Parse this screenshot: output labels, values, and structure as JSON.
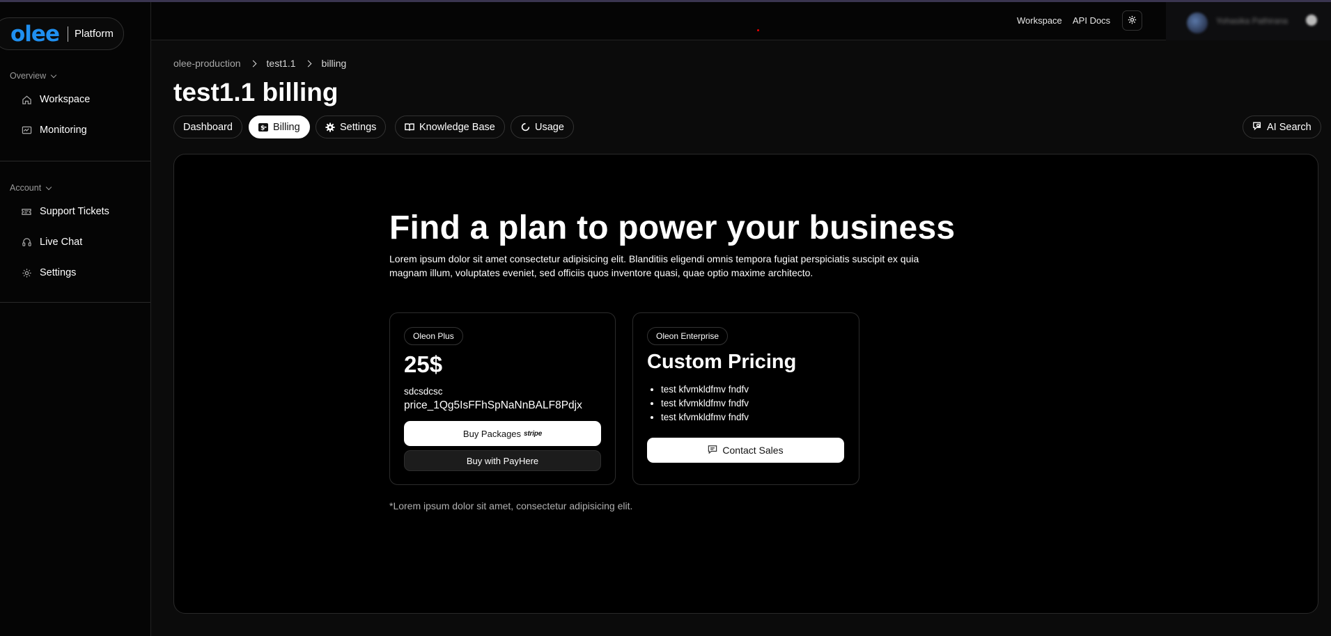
{
  "brand": {
    "logo": "olee",
    "product": "Platform"
  },
  "sidebar": {
    "sections": [
      {
        "label": "Overview",
        "items": [
          {
            "label": "Workspace",
            "icon": "home-icon"
          },
          {
            "label": "Monitoring",
            "icon": "monitor-icon"
          }
        ]
      },
      {
        "label": "Account",
        "items": [
          {
            "label": "Support Tickets",
            "icon": "ticket-icon"
          },
          {
            "label": "Live Chat",
            "icon": "headset-icon"
          },
          {
            "label": "Settings",
            "icon": "gear-icon"
          }
        ]
      }
    ]
  },
  "topbar": {
    "links": [
      "Workspace",
      "API Docs"
    ],
    "theme_icon": "sun-icon",
    "user": {
      "name": "Yohasika Pathirana"
    }
  },
  "breadcrumb": [
    "olee-production",
    "test1.1",
    "billing"
  ],
  "page_title": "test1.1 billing",
  "tabs": [
    {
      "label": "Dashboard",
      "icon": ""
    },
    {
      "label": "Billing",
      "icon": "billing-icon",
      "active": true
    },
    {
      "label": "Settings",
      "icon": "gear-icon"
    },
    {
      "label": "Knowledge Base",
      "icon": "book-icon"
    },
    {
      "label": "Usage",
      "icon": "usage-circle-icon"
    }
  ],
  "ai_search": {
    "label": "AI Search",
    "icon": "ai-search-icon"
  },
  "hero": {
    "title": "Find a plan to power your business",
    "description": "Lorem ipsum dolor sit amet consectetur adipisicing elit. Blanditiis eligendi omnis tempora fugiat perspiciatis suscipit ex quia magnam illum, voluptates eveniet, sed officiis quos inventore quasi, quae optio maxime architecto."
  },
  "plans": [
    {
      "badge": "Oleon Plus",
      "price": "25$",
      "description": "sdcsdcsc",
      "price_id": "price_1Qg5IsFFhSpNaNnBALF8Pdjx",
      "primary_button": "Buy Packages",
      "primary_button_brand": "stripe",
      "secondary_button": "Buy with PayHere"
    },
    {
      "badge": "Oleon Enterprise",
      "price": "Custom Pricing",
      "features": [
        "test kfvmkldfmv fndfv",
        "test kfvmkldfmv fndfv",
        "test kfvmkldfmv fndfv"
      ],
      "button": "Contact Sales",
      "button_icon": "chat-icon"
    }
  ],
  "footnote": "*Lorem ipsum dolor sit amet, consectetur adipisicing elit.",
  "colors": {
    "background": "#0b0b0b",
    "brand": "#1f8ff0",
    "accent": "#ffffff"
  }
}
